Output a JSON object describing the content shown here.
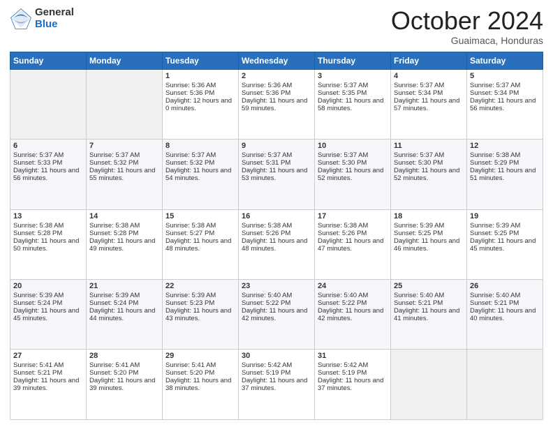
{
  "header": {
    "logo": {
      "general": "General",
      "blue": "Blue"
    },
    "title": "October 2024",
    "subtitle": "Guaimaca, Honduras"
  },
  "weekdays": [
    "Sunday",
    "Monday",
    "Tuesday",
    "Wednesday",
    "Thursday",
    "Friday",
    "Saturday"
  ],
  "weeks": [
    [
      {
        "day": "",
        "empty": true
      },
      {
        "day": "",
        "empty": true
      },
      {
        "day": "1",
        "sunrise": "Sunrise: 5:36 AM",
        "sunset": "Sunset: 5:36 PM",
        "daylight": "Daylight: 12 hours and 0 minutes."
      },
      {
        "day": "2",
        "sunrise": "Sunrise: 5:36 AM",
        "sunset": "Sunset: 5:36 PM",
        "daylight": "Daylight: 11 hours and 59 minutes."
      },
      {
        "day": "3",
        "sunrise": "Sunrise: 5:37 AM",
        "sunset": "Sunset: 5:35 PM",
        "daylight": "Daylight: 11 hours and 58 minutes."
      },
      {
        "day": "4",
        "sunrise": "Sunrise: 5:37 AM",
        "sunset": "Sunset: 5:34 PM",
        "daylight": "Daylight: 11 hours and 57 minutes."
      },
      {
        "day": "5",
        "sunrise": "Sunrise: 5:37 AM",
        "sunset": "Sunset: 5:34 PM",
        "daylight": "Daylight: 11 hours and 56 minutes."
      }
    ],
    [
      {
        "day": "6",
        "sunrise": "Sunrise: 5:37 AM",
        "sunset": "Sunset: 5:33 PM",
        "daylight": "Daylight: 11 hours and 56 minutes."
      },
      {
        "day": "7",
        "sunrise": "Sunrise: 5:37 AM",
        "sunset": "Sunset: 5:32 PM",
        "daylight": "Daylight: 11 hours and 55 minutes."
      },
      {
        "day": "8",
        "sunrise": "Sunrise: 5:37 AM",
        "sunset": "Sunset: 5:32 PM",
        "daylight": "Daylight: 11 hours and 54 minutes."
      },
      {
        "day": "9",
        "sunrise": "Sunrise: 5:37 AM",
        "sunset": "Sunset: 5:31 PM",
        "daylight": "Daylight: 11 hours and 53 minutes."
      },
      {
        "day": "10",
        "sunrise": "Sunrise: 5:37 AM",
        "sunset": "Sunset: 5:30 PM",
        "daylight": "Daylight: 11 hours and 52 minutes."
      },
      {
        "day": "11",
        "sunrise": "Sunrise: 5:37 AM",
        "sunset": "Sunset: 5:30 PM",
        "daylight": "Daylight: 11 hours and 52 minutes."
      },
      {
        "day": "12",
        "sunrise": "Sunrise: 5:38 AM",
        "sunset": "Sunset: 5:29 PM",
        "daylight": "Daylight: 11 hours and 51 minutes."
      }
    ],
    [
      {
        "day": "13",
        "sunrise": "Sunrise: 5:38 AM",
        "sunset": "Sunset: 5:28 PM",
        "daylight": "Daylight: 11 hours and 50 minutes."
      },
      {
        "day": "14",
        "sunrise": "Sunrise: 5:38 AM",
        "sunset": "Sunset: 5:28 PM",
        "daylight": "Daylight: 11 hours and 49 minutes."
      },
      {
        "day": "15",
        "sunrise": "Sunrise: 5:38 AM",
        "sunset": "Sunset: 5:27 PM",
        "daylight": "Daylight: 11 hours and 48 minutes."
      },
      {
        "day": "16",
        "sunrise": "Sunrise: 5:38 AM",
        "sunset": "Sunset: 5:26 PM",
        "daylight": "Daylight: 11 hours and 48 minutes."
      },
      {
        "day": "17",
        "sunrise": "Sunrise: 5:38 AM",
        "sunset": "Sunset: 5:26 PM",
        "daylight": "Daylight: 11 hours and 47 minutes."
      },
      {
        "day": "18",
        "sunrise": "Sunrise: 5:39 AM",
        "sunset": "Sunset: 5:25 PM",
        "daylight": "Daylight: 11 hours and 46 minutes."
      },
      {
        "day": "19",
        "sunrise": "Sunrise: 5:39 AM",
        "sunset": "Sunset: 5:25 PM",
        "daylight": "Daylight: 11 hours and 45 minutes."
      }
    ],
    [
      {
        "day": "20",
        "sunrise": "Sunrise: 5:39 AM",
        "sunset": "Sunset: 5:24 PM",
        "daylight": "Daylight: 11 hours and 45 minutes."
      },
      {
        "day": "21",
        "sunrise": "Sunrise: 5:39 AM",
        "sunset": "Sunset: 5:24 PM",
        "daylight": "Daylight: 11 hours and 44 minutes."
      },
      {
        "day": "22",
        "sunrise": "Sunrise: 5:39 AM",
        "sunset": "Sunset: 5:23 PM",
        "daylight": "Daylight: 11 hours and 43 minutes."
      },
      {
        "day": "23",
        "sunrise": "Sunrise: 5:40 AM",
        "sunset": "Sunset: 5:22 PM",
        "daylight": "Daylight: 11 hours and 42 minutes."
      },
      {
        "day": "24",
        "sunrise": "Sunrise: 5:40 AM",
        "sunset": "Sunset: 5:22 PM",
        "daylight": "Daylight: 11 hours and 42 minutes."
      },
      {
        "day": "25",
        "sunrise": "Sunrise: 5:40 AM",
        "sunset": "Sunset: 5:21 PM",
        "daylight": "Daylight: 11 hours and 41 minutes."
      },
      {
        "day": "26",
        "sunrise": "Sunrise: 5:40 AM",
        "sunset": "Sunset: 5:21 PM",
        "daylight": "Daylight: 11 hours and 40 minutes."
      }
    ],
    [
      {
        "day": "27",
        "sunrise": "Sunrise: 5:41 AM",
        "sunset": "Sunset: 5:21 PM",
        "daylight": "Daylight: 11 hours and 39 minutes."
      },
      {
        "day": "28",
        "sunrise": "Sunrise: 5:41 AM",
        "sunset": "Sunset: 5:20 PM",
        "daylight": "Daylight: 11 hours and 39 minutes."
      },
      {
        "day": "29",
        "sunrise": "Sunrise: 5:41 AM",
        "sunset": "Sunset: 5:20 PM",
        "daylight": "Daylight: 11 hours and 38 minutes."
      },
      {
        "day": "30",
        "sunrise": "Sunrise: 5:42 AM",
        "sunset": "Sunset: 5:19 PM",
        "daylight": "Daylight: 11 hours and 37 minutes."
      },
      {
        "day": "31",
        "sunrise": "Sunrise: 5:42 AM",
        "sunset": "Sunset: 5:19 PM",
        "daylight": "Daylight: 11 hours and 37 minutes."
      },
      {
        "day": "",
        "empty": true
      },
      {
        "day": "",
        "empty": true
      }
    ]
  ]
}
